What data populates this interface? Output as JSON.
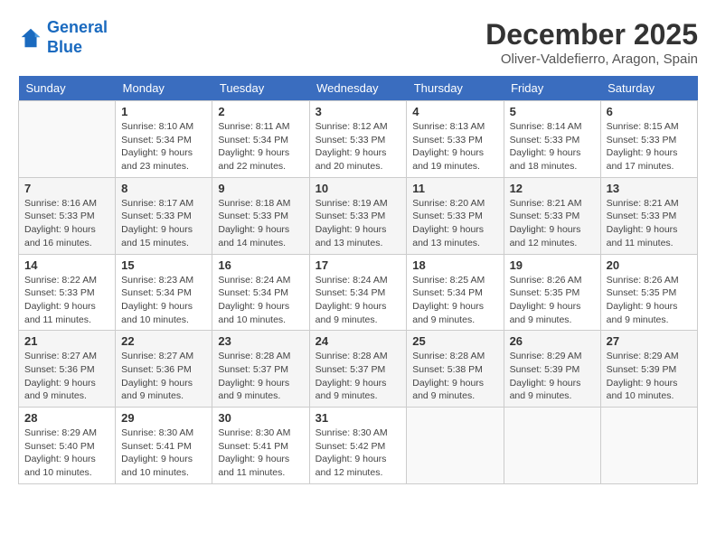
{
  "logo": {
    "line1": "General",
    "line2": "Blue"
  },
  "title": "December 2025",
  "location": "Oliver-Valdefierro, Aragon, Spain",
  "header_days": [
    "Sunday",
    "Monday",
    "Tuesday",
    "Wednesday",
    "Thursday",
    "Friday",
    "Saturday"
  ],
  "weeks": [
    [
      {
        "day": "",
        "info": ""
      },
      {
        "day": "1",
        "info": "Sunrise: 8:10 AM\nSunset: 5:34 PM\nDaylight: 9 hours\nand 23 minutes."
      },
      {
        "day": "2",
        "info": "Sunrise: 8:11 AM\nSunset: 5:34 PM\nDaylight: 9 hours\nand 22 minutes."
      },
      {
        "day": "3",
        "info": "Sunrise: 8:12 AM\nSunset: 5:33 PM\nDaylight: 9 hours\nand 20 minutes."
      },
      {
        "day": "4",
        "info": "Sunrise: 8:13 AM\nSunset: 5:33 PM\nDaylight: 9 hours\nand 19 minutes."
      },
      {
        "day": "5",
        "info": "Sunrise: 8:14 AM\nSunset: 5:33 PM\nDaylight: 9 hours\nand 18 minutes."
      },
      {
        "day": "6",
        "info": "Sunrise: 8:15 AM\nSunset: 5:33 PM\nDaylight: 9 hours\nand 17 minutes."
      }
    ],
    [
      {
        "day": "7",
        "info": "Sunrise: 8:16 AM\nSunset: 5:33 PM\nDaylight: 9 hours\nand 16 minutes."
      },
      {
        "day": "8",
        "info": "Sunrise: 8:17 AM\nSunset: 5:33 PM\nDaylight: 9 hours\nand 15 minutes."
      },
      {
        "day": "9",
        "info": "Sunrise: 8:18 AM\nSunset: 5:33 PM\nDaylight: 9 hours\nand 14 minutes."
      },
      {
        "day": "10",
        "info": "Sunrise: 8:19 AM\nSunset: 5:33 PM\nDaylight: 9 hours\nand 13 minutes."
      },
      {
        "day": "11",
        "info": "Sunrise: 8:20 AM\nSunset: 5:33 PM\nDaylight: 9 hours\nand 13 minutes."
      },
      {
        "day": "12",
        "info": "Sunrise: 8:21 AM\nSunset: 5:33 PM\nDaylight: 9 hours\nand 12 minutes."
      },
      {
        "day": "13",
        "info": "Sunrise: 8:21 AM\nSunset: 5:33 PM\nDaylight: 9 hours\nand 11 minutes."
      }
    ],
    [
      {
        "day": "14",
        "info": "Sunrise: 8:22 AM\nSunset: 5:33 PM\nDaylight: 9 hours\nand 11 minutes."
      },
      {
        "day": "15",
        "info": "Sunrise: 8:23 AM\nSunset: 5:34 PM\nDaylight: 9 hours\nand 10 minutes."
      },
      {
        "day": "16",
        "info": "Sunrise: 8:24 AM\nSunset: 5:34 PM\nDaylight: 9 hours\nand 10 minutes."
      },
      {
        "day": "17",
        "info": "Sunrise: 8:24 AM\nSunset: 5:34 PM\nDaylight: 9 hours\nand 9 minutes."
      },
      {
        "day": "18",
        "info": "Sunrise: 8:25 AM\nSunset: 5:34 PM\nDaylight: 9 hours\nand 9 minutes."
      },
      {
        "day": "19",
        "info": "Sunrise: 8:26 AM\nSunset: 5:35 PM\nDaylight: 9 hours\nand 9 minutes."
      },
      {
        "day": "20",
        "info": "Sunrise: 8:26 AM\nSunset: 5:35 PM\nDaylight: 9 hours\nand 9 minutes."
      }
    ],
    [
      {
        "day": "21",
        "info": "Sunrise: 8:27 AM\nSunset: 5:36 PM\nDaylight: 9 hours\nand 9 minutes."
      },
      {
        "day": "22",
        "info": "Sunrise: 8:27 AM\nSunset: 5:36 PM\nDaylight: 9 hours\nand 9 minutes."
      },
      {
        "day": "23",
        "info": "Sunrise: 8:28 AM\nSunset: 5:37 PM\nDaylight: 9 hours\nand 9 minutes."
      },
      {
        "day": "24",
        "info": "Sunrise: 8:28 AM\nSunset: 5:37 PM\nDaylight: 9 hours\nand 9 minutes."
      },
      {
        "day": "25",
        "info": "Sunrise: 8:28 AM\nSunset: 5:38 PM\nDaylight: 9 hours\nand 9 minutes."
      },
      {
        "day": "26",
        "info": "Sunrise: 8:29 AM\nSunset: 5:39 PM\nDaylight: 9 hours\nand 9 minutes."
      },
      {
        "day": "27",
        "info": "Sunrise: 8:29 AM\nSunset: 5:39 PM\nDaylight: 9 hours\nand 10 minutes."
      }
    ],
    [
      {
        "day": "28",
        "info": "Sunrise: 8:29 AM\nSunset: 5:40 PM\nDaylight: 9 hours\nand 10 minutes."
      },
      {
        "day": "29",
        "info": "Sunrise: 8:30 AM\nSunset: 5:41 PM\nDaylight: 9 hours\nand 10 minutes."
      },
      {
        "day": "30",
        "info": "Sunrise: 8:30 AM\nSunset: 5:41 PM\nDaylight: 9 hours\nand 11 minutes."
      },
      {
        "day": "31",
        "info": "Sunrise: 8:30 AM\nSunset: 5:42 PM\nDaylight: 9 hours\nand 12 minutes."
      },
      {
        "day": "",
        "info": ""
      },
      {
        "day": "",
        "info": ""
      },
      {
        "day": "",
        "info": ""
      }
    ]
  ]
}
